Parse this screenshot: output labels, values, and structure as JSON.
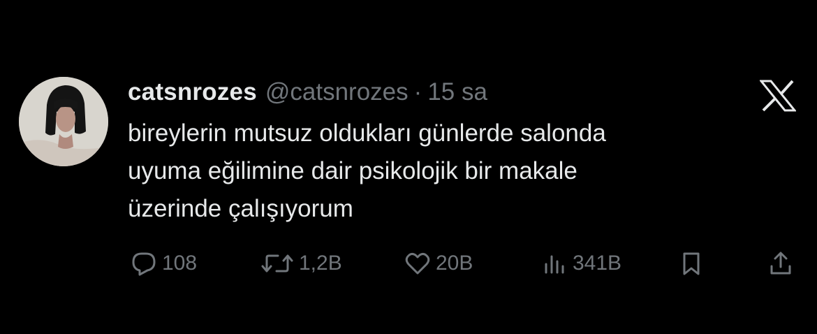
{
  "tweet": {
    "author": {
      "display_name": "catsnrozes",
      "handle": "@catsnrozes",
      "separator": "·",
      "time": "15 sa"
    },
    "text_lines": [
      "bireylerin mutsuz oldukları günlerde salonda",
      "uyuma eğilimine dair psikolojik bir makale",
      "üzerinde çalışıyorum"
    ],
    "actions": {
      "reply": {
        "icon": "reply-icon",
        "count": "108"
      },
      "repost": {
        "icon": "repost-icon",
        "count": "1,2B"
      },
      "like": {
        "icon": "heart-icon",
        "count": "20B"
      },
      "views": {
        "icon": "views-icon",
        "count": "341B"
      },
      "bookmark": {
        "icon": "bookmark-icon"
      },
      "share": {
        "icon": "share-icon"
      }
    },
    "brand_icon": "x-logo-icon"
  },
  "colors": {
    "background": "#000000",
    "primary_text": "#e7e9ea",
    "secondary_text": "#71767b"
  }
}
